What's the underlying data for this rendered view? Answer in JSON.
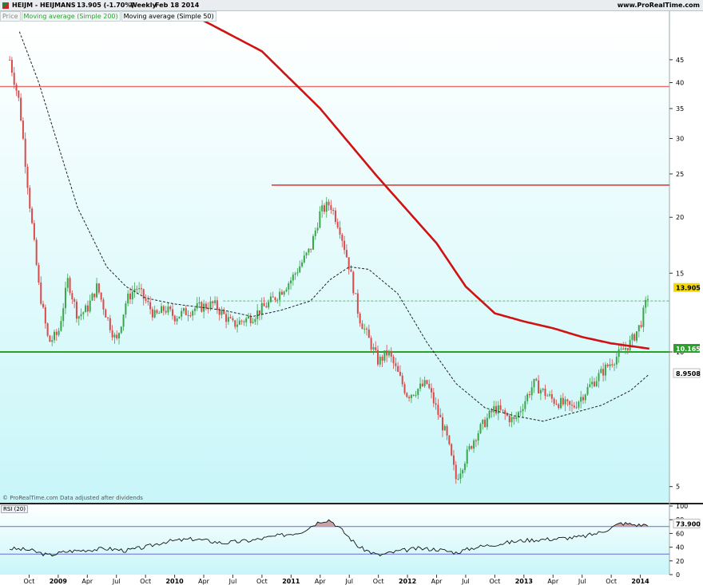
{
  "header": {
    "symbol": "HEIJM - HEIJMANS",
    "change": "13.905 (-1.70%)",
    "period": "Weekly",
    "date": "Feb 18 2014",
    "site": "www.ProRealTime.com"
  },
  "legend": {
    "price": "Price",
    "ma200": "Moving average (Simple 200)",
    "ma50": "Moving average (Simple 50)"
  },
  "footer_note": "© ProRealTime.com Data adjusted after dividends",
  "rsi_label": "RSI (20)",
  "colors": {
    "background_top": "#ffffff",
    "background_bottom": "#c8f6f9",
    "candle_up": "#3aa64a",
    "candle_down": "#d94a4a",
    "ma200": "#d01212",
    "ma50": "#222222",
    "support_line": "#2aa12a",
    "resistance_line": "#e02020",
    "rsi_line": "#111111",
    "rsi_band": "#6a6adf"
  },
  "chart_data": [
    {
      "type": "candlestick",
      "title": "HEIJM - HEIJMANS",
      "period": "Weekly",
      "y_scale": "log",
      "ylim": [
        4.6,
        55
      ],
      "y_ticks": [
        5,
        10,
        15,
        20,
        25,
        30,
        35,
        40,
        45
      ],
      "x_ticks": [
        "Oct",
        "2009",
        "Apr",
        "Jul",
        "Oct",
        "2010",
        "Apr",
        "Jul",
        "Oct",
        "2011",
        "Apr",
        "Jul",
        "Oct",
        "2012",
        "Apr",
        "Jul",
        "Oct",
        "2013",
        "Apr",
        "Jul",
        "Oct",
        "2014"
      ],
      "price_path": [
        [
          "2008-08",
          45
        ],
        [
          "2008-09",
          36
        ],
        [
          "2008-10",
          22
        ],
        [
          "2008-11",
          14
        ],
        [
          "2008-12",
          10.5
        ],
        [
          "2009-01",
          11
        ],
        [
          "2009-02",
          14.5
        ],
        [
          "2009-03",
          12
        ],
        [
          "2009-04",
          12.5
        ],
        [
          "2009-05",
          14
        ],
        [
          "2009-06",
          12
        ],
        [
          "2009-07",
          10.5
        ],
        [
          "2009-08",
          13
        ],
        [
          "2009-09",
          14
        ],
        [
          "2009-10",
          13
        ],
        [
          "2009-11",
          12
        ],
        [
          "2009-12",
          12.5
        ],
        [
          "2010-01",
          12
        ],
        [
          "2010-03",
          12.5
        ],
        [
          "2010-05",
          12.8
        ],
        [
          "2010-07",
          11.5
        ],
        [
          "2010-09",
          12
        ],
        [
          "2010-11",
          13
        ],
        [
          "2011-01",
          14.5
        ],
        [
          "2011-03",
          17
        ],
        [
          "2011-04",
          20.5
        ],
        [
          "2011-05",
          21.5
        ],
        [
          "2011-06",
          19
        ],
        [
          "2011-07",
          15.5
        ],
        [
          "2011-08",
          12
        ],
        [
          "2011-10",
          9.5
        ],
        [
          "2011-11",
          10
        ],
        [
          "2012-01",
          8
        ],
        [
          "2012-03",
          8.5
        ],
        [
          "2012-05",
          6.5
        ],
        [
          "2012-06",
          5.2
        ],
        [
          "2012-08",
          6.5
        ],
        [
          "2012-10",
          7.5
        ],
        [
          "2012-12",
          7
        ],
        [
          "2013-02",
          8.5
        ],
        [
          "2013-04",
          7.8
        ],
        [
          "2013-06",
          7.5
        ],
        [
          "2013-08",
          8.5
        ],
        [
          "2013-10",
          9.5
        ],
        [
          "2013-12",
          10.5
        ],
        [
          "2014-01",
          11.5
        ],
        [
          "2014-02",
          13.905
        ]
      ],
      "series": [
        {
          "name": "Moving average (Simple 200)",
          "style": "solid-thick",
          "points": [
            [
              "2010-04",
              55
            ],
            [
              "2010-10",
              47
            ],
            [
              "2011-04",
              35
            ],
            [
              "2011-10",
              24.5
            ],
            [
              "2012-04",
              17.5
            ],
            [
              "2012-07",
              14
            ],
            [
              "2012-10",
              12.2
            ],
            [
              "2013-01",
              11.7
            ],
            [
              "2013-04",
              11.3
            ],
            [
              "2013-07",
              10.8
            ],
            [
              "2013-10",
              10.45
            ],
            [
              "2014-02",
              10.165
            ]
          ]
        },
        {
          "name": "Moving average (Simple 50)",
          "style": "dashed",
          "points": [
            [
              "2008-09",
              52
            ],
            [
              "2008-11",
              40
            ],
            [
              "2009-03",
              21
            ],
            [
              "2009-06",
              15.5
            ],
            [
              "2009-08",
              14
            ],
            [
              "2009-10",
              13.2
            ],
            [
              "2010-01",
              12.8
            ],
            [
              "2010-06",
              12.4
            ],
            [
              "2010-09",
              12
            ],
            [
              "2010-12",
              12.4
            ],
            [
              "2011-03",
              13
            ],
            [
              "2011-05",
              14.5
            ],
            [
              "2011-07",
              15.5
            ],
            [
              "2011-09",
              15.3
            ],
            [
              "2011-12",
              13.5
            ],
            [
              "2012-03",
              10.5
            ],
            [
              "2012-06",
              8.5
            ],
            [
              "2012-09",
              7.5
            ],
            [
              "2012-12",
              7.2
            ],
            [
              "2013-03",
              7
            ],
            [
              "2013-06",
              7.3
            ],
            [
              "2013-09",
              7.6
            ],
            [
              "2013-12",
              8.2
            ],
            [
              "2014-02",
              8.9508
            ]
          ]
        }
      ],
      "horizontal_lines": [
        {
          "value": 39.2,
          "color": "#e86a6a",
          "from": "2008-07",
          "to": "2014-04"
        },
        {
          "value": 23.6,
          "color": "#e02020",
          "from": "2010-11",
          "to": "2014-04"
        },
        {
          "value": 10.0,
          "color": "#2aa12a",
          "from": "2008-07",
          "to": "2014-04"
        },
        {
          "value": 13.0,
          "color": "#7fc77f",
          "style": "dashed",
          "from": "2010-06",
          "to": "2014-04"
        }
      ],
      "value_labels": [
        {
          "text": "13.905",
          "value": 13.905,
          "bg": "#f5d800"
        },
        {
          "text": "10.165",
          "value": 10.165,
          "bg": "#2aa12a"
        },
        {
          "text": "8.9508",
          "value": 8.9508,
          "bg": "#ffffff"
        }
      ]
    },
    {
      "type": "line",
      "title": "RSI (20)",
      "ylim": [
        0,
        100
      ],
      "y_ticks": [
        0,
        20,
        40,
        60,
        80,
        100
      ],
      "bands": [
        30,
        70
      ],
      "last_value": "73.900",
      "values": [
        [
          "2008-08",
          38
        ],
        [
          "2008-10",
          36
        ],
        [
          "2008-12",
          28
        ],
        [
          "2009-02",
          34
        ],
        [
          "2009-04",
          36
        ],
        [
          "2009-06",
          38
        ],
        [
          "2009-08",
          35
        ],
        [
          "2009-10",
          40
        ],
        [
          "2009-12",
          48
        ],
        [
          "2010-03",
          52
        ],
        [
          "2010-06",
          46
        ],
        [
          "2010-09",
          50
        ],
        [
          "2010-11",
          55
        ],
        [
          "2011-02",
          62
        ],
        [
          "2011-04",
          78
        ],
        [
          "2011-05",
          80
        ],
        [
          "2011-06",
          68
        ],
        [
          "2011-08",
          40
        ],
        [
          "2011-10",
          28
        ],
        [
          "2011-12",
          34
        ],
        [
          "2012-02",
          38
        ],
        [
          "2012-04",
          37
        ],
        [
          "2012-06",
          32
        ],
        [
          "2012-08",
          40
        ],
        [
          "2012-10",
          44
        ],
        [
          "2013-01",
          50
        ],
        [
          "2013-04",
          52
        ],
        [
          "2013-07",
          55
        ],
        [
          "2013-09",
          62
        ],
        [
          "2013-11",
          75
        ],
        [
          "2014-01",
          72
        ],
        [
          "2014-02",
          73.9
        ]
      ]
    }
  ]
}
